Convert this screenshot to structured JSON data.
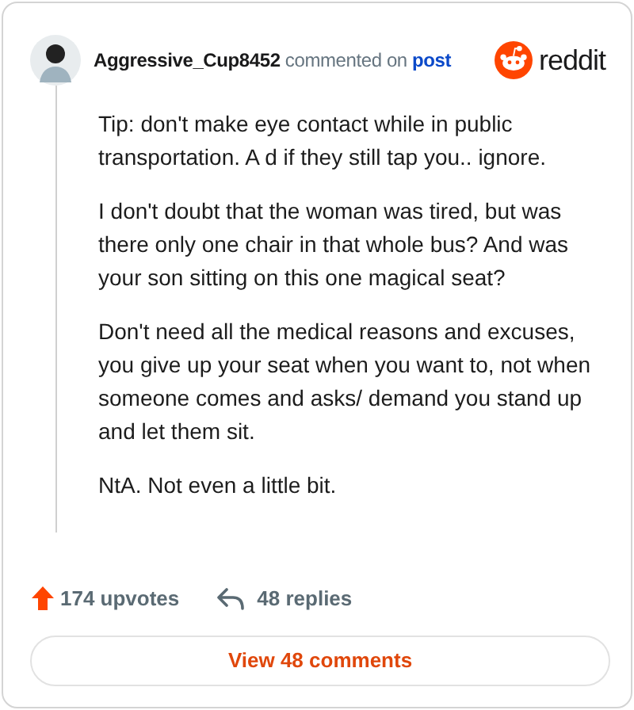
{
  "comment": {
    "author": "Aggressive_Cup8452",
    "action": "commented on",
    "target": "post",
    "brand": "reddit",
    "paragraphs": [
      "Tip: don't make eye contact while in public transportation. A d if they still tap you.. ignore.",
      "I don't doubt that the woman was tired, but was there only one chair in that whole bus? And was your son sitting on this one magical seat?",
      "Don't need all the medical reasons and excuses, you give up your seat when you want to, not when someone comes and asks/ demand you stand up and let them sit.",
      "NtA. Not even a little bit."
    ]
  },
  "footer": {
    "upvotes": "174 upvotes",
    "replies": "48 replies"
  },
  "button": {
    "label": "View 48 comments"
  }
}
